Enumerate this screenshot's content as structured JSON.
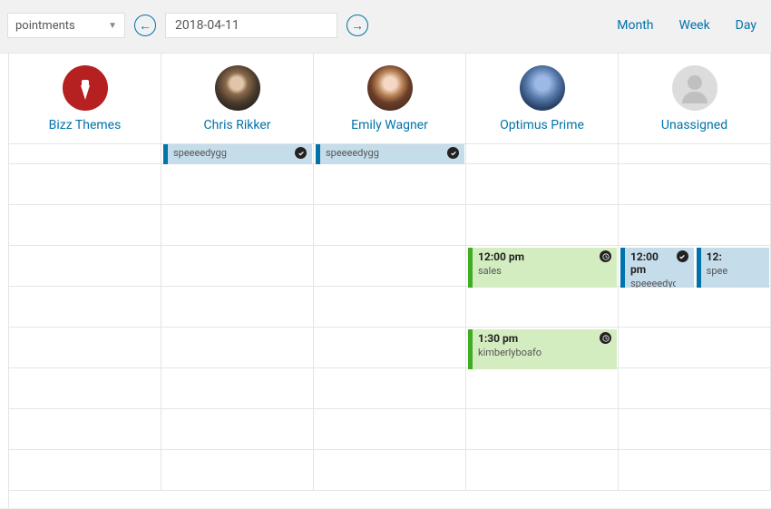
{
  "toolbar": {
    "filter_label": "pointments",
    "date": "2018-04-11",
    "views": {
      "month": "Month",
      "week": "Week",
      "day": "Day"
    }
  },
  "staff": [
    {
      "name": "Bizz Themes",
      "avatar": "bizz"
    },
    {
      "name": "Chris Rikker",
      "avatar": "chris"
    },
    {
      "name": "Emily Wagner",
      "avatar": "emily"
    },
    {
      "name": "Optimus Prime",
      "avatar": "optimus"
    },
    {
      "name": "Unassigned",
      "avatar": "unassigned"
    }
  ],
  "appointments": {
    "chris_1": {
      "customer": "speeeedygg",
      "status": "confirmed"
    },
    "emily_1": {
      "customer": "speeeedygg",
      "status": "confirmed"
    },
    "optimus_1": {
      "time": "12:00 pm",
      "customer": "sales",
      "status": "pending"
    },
    "optimus_2": {
      "time": "1:30 pm",
      "customer": "kimberlyboafo",
      "status": "pending"
    },
    "unassigned_1": {
      "time": "12:00 pm",
      "customer": "speeeedygg",
      "status": "confirmed"
    },
    "unassigned_2": {
      "time": "12:",
      "customer": "spee",
      "status": "pending"
    }
  },
  "icons": {
    "confirmed": "check-circle",
    "pending": "clock"
  }
}
